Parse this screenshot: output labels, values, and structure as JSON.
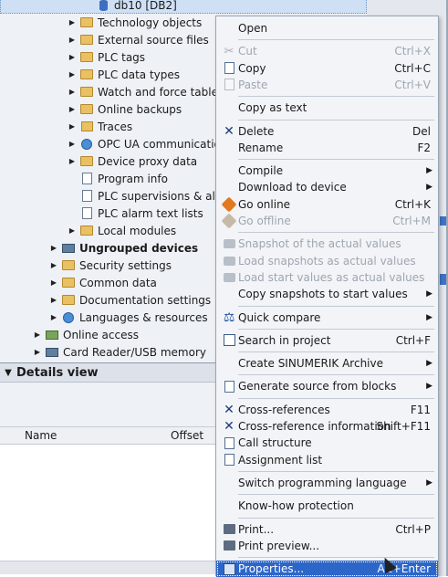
{
  "tree": {
    "items": [
      {
        "label": "db10 [DB2]",
        "icon": "db-icon",
        "indent": 3,
        "arrow": "",
        "bold": false,
        "selected": true
      },
      {
        "label": "Technology objects",
        "icon": "folder-icon",
        "indent": 2,
        "arrow": "▶",
        "bold": false,
        "selected": false
      },
      {
        "label": "External source files",
        "icon": "folder-icon",
        "indent": 2,
        "arrow": "▶",
        "bold": false,
        "selected": false
      },
      {
        "label": "PLC tags",
        "icon": "folder-icon",
        "indent": 2,
        "arrow": "▶",
        "bold": false,
        "selected": false
      },
      {
        "label": "PLC data types",
        "icon": "folder-icon",
        "indent": 2,
        "arrow": "▶",
        "bold": false,
        "selected": false
      },
      {
        "label": "Watch and force tables",
        "icon": "folder-icon",
        "indent": 2,
        "arrow": "▶",
        "bold": false,
        "selected": false
      },
      {
        "label": "Online backups",
        "icon": "folder-icon",
        "indent": 2,
        "arrow": "▶",
        "bold": false,
        "selected": false
      },
      {
        "label": "Traces",
        "icon": "trace-icon",
        "indent": 2,
        "arrow": "▶",
        "bold": false,
        "selected": false
      },
      {
        "label": "OPC UA communication",
        "icon": "opc-ua-icon",
        "indent": 2,
        "arrow": "▶",
        "bold": false,
        "selected": false
      },
      {
        "label": "Device proxy data",
        "icon": "folder-icon",
        "indent": 2,
        "arrow": "▶",
        "bold": false,
        "selected": false
      },
      {
        "label": "Program info",
        "icon": "document-icon",
        "indent": 2,
        "arrow": "",
        "bold": false,
        "selected": false
      },
      {
        "label": "PLC supervisions & alarms",
        "icon": "document-icon",
        "indent": 2,
        "arrow": "",
        "bold": false,
        "selected": false
      },
      {
        "label": "PLC alarm text lists",
        "icon": "document-icon",
        "indent": 2,
        "arrow": "",
        "bold": false,
        "selected": false
      },
      {
        "label": "Local modules",
        "icon": "folder-icon",
        "indent": 2,
        "arrow": "▶",
        "bold": false,
        "selected": false
      },
      {
        "label": "Ungrouped devices",
        "icon": "devices-icon",
        "indent": 1,
        "arrow": "▶",
        "bold": true,
        "selected": false
      },
      {
        "label": "Security settings",
        "icon": "folder-icon",
        "indent": 1,
        "arrow": "▶",
        "bold": false,
        "selected": false
      },
      {
        "label": "Common data",
        "icon": "folder-icon",
        "indent": 1,
        "arrow": "▶",
        "bold": false,
        "selected": false
      },
      {
        "label": "Documentation settings",
        "icon": "folder-icon",
        "indent": 1,
        "arrow": "▶",
        "bold": false,
        "selected": false
      },
      {
        "label": "Languages & resources",
        "icon": "globe-icon",
        "indent": 1,
        "arrow": "▶",
        "bold": false,
        "selected": false
      },
      {
        "label": "Online access",
        "icon": "online-access-icon",
        "indent": 0,
        "arrow": "▶",
        "bold": false,
        "selected": false
      },
      {
        "label": "Card Reader/USB memory",
        "icon": "card-reader-icon",
        "indent": 0,
        "arrow": "▶",
        "bold": false,
        "selected": false
      }
    ]
  },
  "details": {
    "title": "Details view",
    "columns": [
      "Name",
      "Offset"
    ]
  },
  "menu": {
    "items": [
      {
        "type": "item",
        "label": "Open",
        "shortcut": "",
        "icon": "",
        "disabled": false,
        "submenu": false
      },
      {
        "type": "sep"
      },
      {
        "type": "item",
        "label": "Cut",
        "shortcut": "Ctrl+X",
        "icon": "cut-icon",
        "disabled": true,
        "submenu": false
      },
      {
        "type": "item",
        "label": "Copy",
        "shortcut": "Ctrl+C",
        "icon": "copy-icon",
        "disabled": false,
        "submenu": false
      },
      {
        "type": "item",
        "label": "Paste",
        "shortcut": "Ctrl+V",
        "icon": "paste-icon",
        "disabled": true,
        "submenu": false
      },
      {
        "type": "sep"
      },
      {
        "type": "item",
        "label": "Copy as text",
        "shortcut": "",
        "icon": "",
        "disabled": false,
        "submenu": false
      },
      {
        "type": "sep"
      },
      {
        "type": "item",
        "label": "Delete",
        "shortcut": "Del",
        "icon": "delete-icon",
        "disabled": false,
        "submenu": false
      },
      {
        "type": "item",
        "label": "Rename",
        "shortcut": "F2",
        "icon": "",
        "disabled": false,
        "submenu": false
      },
      {
        "type": "sep"
      },
      {
        "type": "item",
        "label": "Compile",
        "shortcut": "",
        "icon": "",
        "disabled": false,
        "submenu": true
      },
      {
        "type": "item",
        "label": "Download to device",
        "shortcut": "",
        "icon": "",
        "disabled": false,
        "submenu": true
      },
      {
        "type": "item",
        "label": "Go online",
        "shortcut": "Ctrl+K",
        "icon": "go-online-icon",
        "disabled": false,
        "submenu": false
      },
      {
        "type": "item",
        "label": "Go offline",
        "shortcut": "Ctrl+M",
        "icon": "go-offline-icon",
        "disabled": true,
        "submenu": false
      },
      {
        "type": "sep"
      },
      {
        "type": "item",
        "label": "Snapshot of the actual values",
        "shortcut": "",
        "icon": "snapshot-icon",
        "disabled": true,
        "submenu": false
      },
      {
        "type": "item",
        "label": "Load snapshots as actual values",
        "shortcut": "",
        "icon": "load-snapshot-icon",
        "disabled": true,
        "submenu": false
      },
      {
        "type": "item",
        "label": "Load start values as actual values",
        "shortcut": "",
        "icon": "load-start-values-icon",
        "disabled": true,
        "submenu": false
      },
      {
        "type": "item",
        "label": "Copy snapshots to start values",
        "shortcut": "",
        "icon": "",
        "disabled": false,
        "submenu": true
      },
      {
        "type": "sep"
      },
      {
        "type": "item",
        "label": "Quick compare",
        "shortcut": "",
        "icon": "quick-compare-icon",
        "disabled": false,
        "submenu": true
      },
      {
        "type": "sep"
      },
      {
        "type": "item",
        "label": "Search in project",
        "shortcut": "Ctrl+F",
        "icon": "search-project-icon",
        "disabled": false,
        "submenu": false
      },
      {
        "type": "sep"
      },
      {
        "type": "item",
        "label": "Create SINUMERIK Archive",
        "shortcut": "",
        "icon": "",
        "disabled": false,
        "submenu": true
      },
      {
        "type": "sep"
      },
      {
        "type": "item",
        "label": "Generate source from blocks",
        "shortcut": "",
        "icon": "generate-source-icon",
        "disabled": false,
        "submenu": true
      },
      {
        "type": "sep"
      },
      {
        "type": "item",
        "label": "Cross-references",
        "shortcut": "F11",
        "icon": "cross-references-icon",
        "disabled": false,
        "submenu": false
      },
      {
        "type": "item",
        "label": "Cross-reference information",
        "shortcut": "Shift+F11",
        "icon": "cross-reference-info-icon",
        "disabled": false,
        "submenu": false
      },
      {
        "type": "item",
        "label": "Call structure",
        "shortcut": "",
        "icon": "call-structure-icon",
        "disabled": false,
        "submenu": false
      },
      {
        "type": "item",
        "label": "Assignment list",
        "shortcut": "",
        "icon": "assignment-list-icon",
        "disabled": false,
        "submenu": false
      },
      {
        "type": "sep"
      },
      {
        "type": "item",
        "label": "Switch programming language",
        "shortcut": "",
        "icon": "",
        "disabled": false,
        "submenu": true
      },
      {
        "type": "sep"
      },
      {
        "type": "item",
        "label": "Know-how protection",
        "shortcut": "",
        "icon": "",
        "disabled": false,
        "submenu": false
      },
      {
        "type": "sep"
      },
      {
        "type": "item",
        "label": "Print...",
        "shortcut": "Ctrl+P",
        "icon": "print-icon",
        "disabled": false,
        "submenu": false
      },
      {
        "type": "item",
        "label": "Print preview...",
        "shortcut": "",
        "icon": "print-preview-icon",
        "disabled": false,
        "submenu": false
      },
      {
        "type": "sep"
      },
      {
        "type": "item",
        "label": "Properties...",
        "shortcut": "Alt+Enter",
        "icon": "properties-icon",
        "disabled": false,
        "submenu": false,
        "highlighted": true
      }
    ]
  },
  "colors": {
    "highlight": "#2c66c9",
    "tree_bg": "#eef1f6",
    "menu_bg": "#f2f4f7"
  }
}
